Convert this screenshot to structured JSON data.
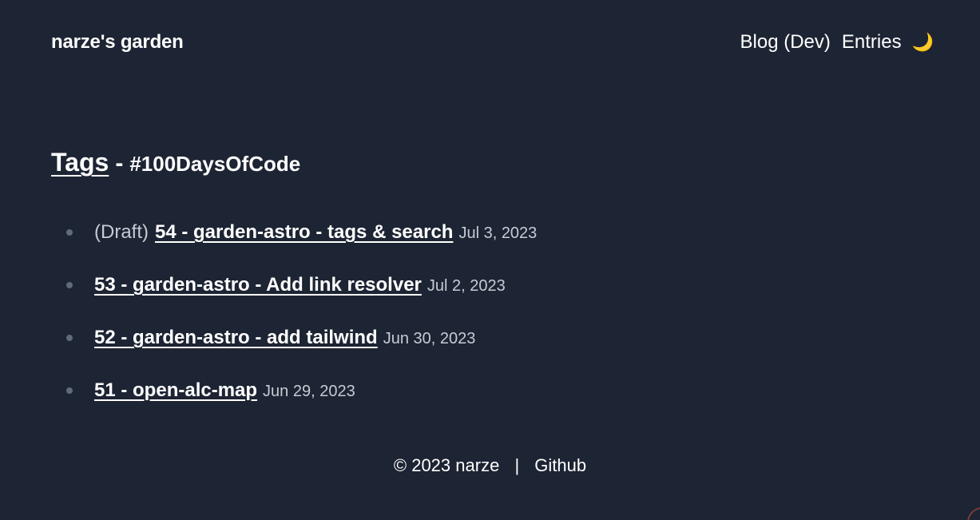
{
  "site": {
    "title": "narze's garden"
  },
  "nav": {
    "items": [
      {
        "label": "Blog (Dev)"
      },
      {
        "label": "Entries"
      }
    ],
    "theme_toggle_icon": "🌙"
  },
  "heading": {
    "tags_label": "Tags",
    "separator": "-",
    "tag": "#100DaysOfCode"
  },
  "entries": [
    {
      "prefix": "(Draft)",
      "title": "54 - garden-astro - tags & search",
      "date": "Jul 3, 2023"
    },
    {
      "prefix": "",
      "title": "53 - garden-astro - Add link resolver",
      "date": "Jul 2, 2023"
    },
    {
      "prefix": "",
      "title": "52 - garden-astro - add tailwind",
      "date": "Jun 30, 2023"
    },
    {
      "prefix": "",
      "title": "51 - open-alc-map",
      "date": "Jun 29, 2023"
    }
  ],
  "footer": {
    "copyright": "© 2023 narze",
    "divider": "|",
    "github_label": "Github"
  },
  "colors": {
    "background": "#1d2433",
    "text": "#ffffff",
    "muted": "#c6cbd4",
    "bullet": "#5f6a7c"
  }
}
